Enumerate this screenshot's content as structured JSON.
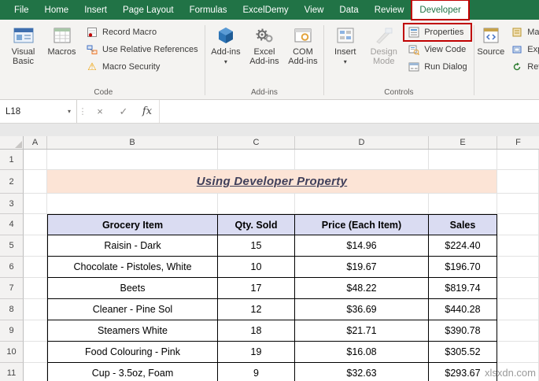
{
  "colors": {
    "ribbon_green": "#217346",
    "highlight_red": "#C00000",
    "title_fill": "#FCE4D6",
    "table_header_fill": "#DADCF2"
  },
  "icons": {
    "dropdown": "▾",
    "cancel": "×",
    "enter": "✓",
    "fx": "fx",
    "warning": "⚠",
    "dots": "⋮"
  },
  "tabs": [
    "File",
    "Home",
    "Insert",
    "Page Layout",
    "Formulas",
    "ExcelDemy",
    "View",
    "Data",
    "Review",
    "Developer"
  ],
  "ribbon": {
    "code": {
      "label": "Code",
      "visual_basic": "Visual Basic",
      "macros": "Macros",
      "record_macro": "Record Macro",
      "use_relative_references": "Use Relative References",
      "macro_security": "Macro Security"
    },
    "addins": {
      "label": "Add-ins",
      "addins_btn": "Add-ins",
      "excel_addins": "Excel Add-ins",
      "com_addins": "COM Add-ins"
    },
    "controls": {
      "label": "Controls",
      "insert": "Insert",
      "design_mode": "Design Mode",
      "properties": "Properties",
      "view_code": "View Code",
      "run_dialog": "Run Dialog"
    },
    "xml": {
      "source": "Source",
      "map": "Map",
      "exp": "Exp",
      "ref": "Ref"
    }
  },
  "formula_bar": {
    "name_box": "L18",
    "formula": ""
  },
  "sheet": {
    "columns": [
      "A",
      "B",
      "C",
      "D",
      "E",
      "F"
    ],
    "rows": [
      "1",
      "2",
      "3",
      "4",
      "5",
      "6",
      "7",
      "8",
      "9",
      "10",
      "11"
    ],
    "title": "Using Developer Property",
    "table": {
      "headers": [
        "Grocery Item",
        "Qty. Sold",
        "Price (Each Item)",
        "Sales"
      ],
      "rows": [
        [
          "Raisin - Dark",
          "15",
          "$14.96",
          "$224.40"
        ],
        [
          "Chocolate - Pistoles, White",
          "10",
          "$19.67",
          "$196.70"
        ],
        [
          "Beets",
          "17",
          "$48.22",
          "$819.74"
        ],
        [
          "Cleaner - Pine Sol",
          "12",
          "$36.69",
          "$440.28"
        ],
        [
          "Steamers White",
          "18",
          "$21.71",
          "$390.78"
        ],
        [
          "Food Colouring - Pink",
          "19",
          "$16.08",
          "$305.52"
        ],
        [
          "Cup - 3.5oz, Foam",
          "9",
          "$32.63",
          "$293.67"
        ]
      ]
    }
  },
  "watermark": "xlsxdn.com"
}
